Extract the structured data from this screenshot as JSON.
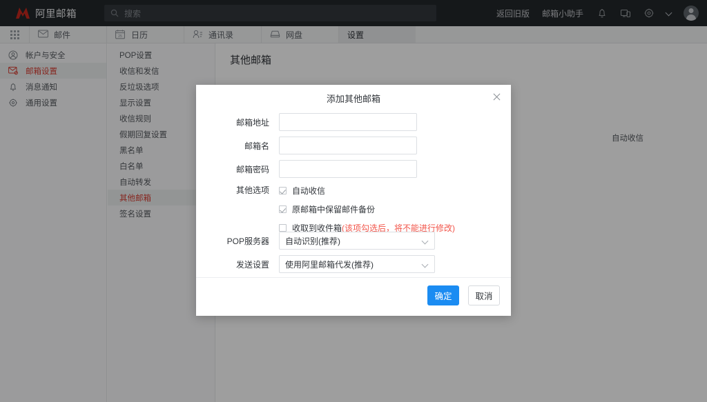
{
  "header": {
    "brand_name": "阿里邮箱",
    "search_placeholder": "搜索",
    "links": [
      {
        "name": "back-to-old-version",
        "label": "返回旧版"
      },
      {
        "name": "mail-assistant",
        "label": "邮箱小助手"
      }
    ],
    "icons": [
      {
        "name": "bell-icon"
      },
      {
        "name": "devices-icon"
      },
      {
        "name": "gear-icon"
      },
      {
        "name": "chevron-down-icon"
      },
      {
        "name": "avatar"
      }
    ]
  },
  "nav_tabs": [
    {
      "label": "邮件",
      "icon": "envelope-icon",
      "active": false
    },
    {
      "label": "日历",
      "icon": "calendar-icon",
      "active": false
    },
    {
      "label": "通讯录",
      "icon": "contacts-icon",
      "active": false
    },
    {
      "label": "网盘",
      "icon": "drive-icon",
      "active": false
    },
    {
      "label": "设置",
      "icon": "none",
      "active": true
    }
  ],
  "sidebar_primary": [
    {
      "label": "帐户与安全",
      "icon": "user-circle-icon",
      "active": false
    },
    {
      "label": "邮箱设置",
      "icon": "mail-settings-icon",
      "active": true
    },
    {
      "label": "消息通知",
      "icon": "bell-icon",
      "active": false
    },
    {
      "label": "通用设置",
      "icon": "gear-icon",
      "active": false
    }
  ],
  "sidebar_secondary": [
    {
      "label": "POP设置",
      "active": false
    },
    {
      "label": "收信和发信",
      "active": false
    },
    {
      "label": "反垃圾选项",
      "active": false
    },
    {
      "label": "显示设置",
      "active": false
    },
    {
      "label": "收信规则",
      "active": false
    },
    {
      "label": "假期回复设置",
      "active": false
    },
    {
      "label": "黑名单",
      "active": false
    },
    {
      "label": "白名单",
      "active": false
    },
    {
      "label": "自动转发",
      "active": false
    },
    {
      "label": "其他邮箱",
      "active": true
    },
    {
      "label": "签名设置",
      "active": false
    }
  ],
  "main": {
    "page_title": "其他邮箱",
    "add_button_label": "",
    "auto_receive_label": "自动收信"
  },
  "modal": {
    "title": "添加其他邮箱",
    "close_icon": "close-icon",
    "fields": [
      {
        "label": "邮箱地址",
        "value": "",
        "placeholder": ""
      },
      {
        "label": "邮箱名",
        "value": "",
        "placeholder": ""
      },
      {
        "label": "邮箱密码",
        "value": "",
        "placeholder": ""
      }
    ],
    "options_label": "其他选项",
    "options": [
      {
        "text": "自动收信",
        "checked": true,
        "warning": ""
      },
      {
        "text": "原邮箱中保留邮件备份",
        "checked": true,
        "warning": ""
      },
      {
        "text": "收取到收件箱",
        "checked": false,
        "warning": "(该项勾选后，将不能进行修改)"
      }
    ],
    "selects": [
      {
        "label": "POP服务器",
        "value": "自动识别(推荐)"
      },
      {
        "label": "发送设置",
        "value": "使用阿里邮箱代发(推荐)"
      }
    ],
    "confirm_label": "确定",
    "cancel_label": "取消"
  },
  "colors": {
    "accent_blue": "#1b8cf2",
    "brand_red": "#d93f34",
    "warning_red": "#f2554a",
    "header_bg": "#23272b",
    "button_blue": "#0b5ca8"
  }
}
